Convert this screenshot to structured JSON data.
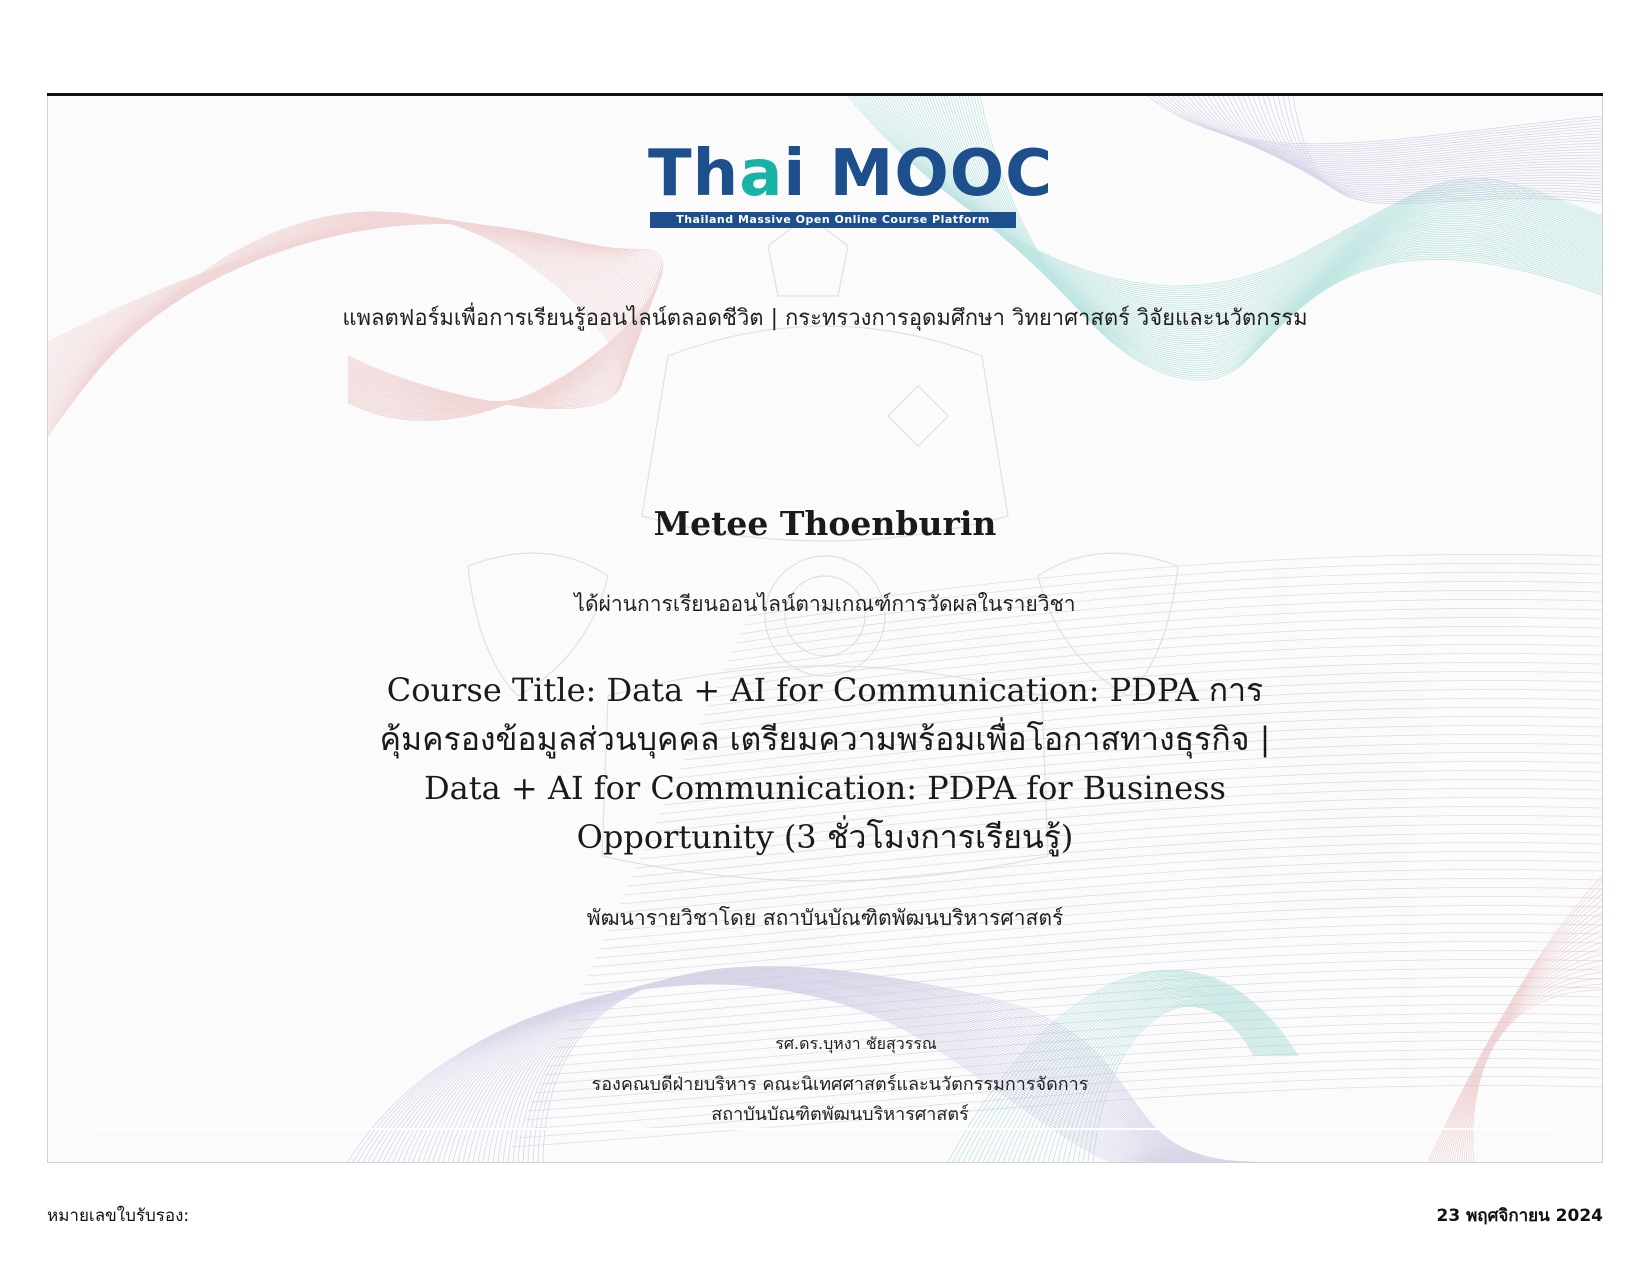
{
  "logo": {
    "word_prefix": "Th",
    "word_accent": "a",
    "word_suffix": "i MOOC",
    "tagline": "Thailand Massive Open Online Course Platform"
  },
  "certificate": {
    "platform_line": "แพลตฟอร์มเพื่อการเรียนรู้ออนไลน์ตลอดชีวิต | กระทรวงการอุดมศึกษา วิทยาศาสตร์ วิจัยและนวัตกรรม",
    "recipient_name": "Metee Thoenburin",
    "passed_line": "ได้ผ่านการเรียนออนไลน์ตามเกณฑ์การวัดผลในรายวิชา",
    "course_title": "Course Title: Data + AI for Communication: PDPA การคุ้มครองข้อมูลส่วนบุคคล เตรียมความพร้อมเพื่อโอกาสทางธุรกิจ | Data + AI for Communication: PDPA for Business Opportunity (3 ชั่วโมงการเรียนรู้)",
    "developer_line": "พัฒนารายวิชาโดย สถาบันบัณฑิตพัฒนบริหารศาสตร์",
    "signer_name": "รศ.ดร.บุหงา ชัยสุวรรณ",
    "signer_role_1": "รองคณบดีฝ่ายบริหาร คณะนิเทศศาสตร์และนวัตกรรมการจัดการ",
    "signer_role_2": "สถาบันบัณฑิตพัฒนบริหารศาสตร์"
  },
  "footer": {
    "cert_number_label": "หมายเลขใบรับรอง:",
    "issue_date": "23 พฤศจิกายน 2024"
  },
  "colors": {
    "logo_blue": "#1d4f8c",
    "logo_teal": "#17b3a6"
  }
}
